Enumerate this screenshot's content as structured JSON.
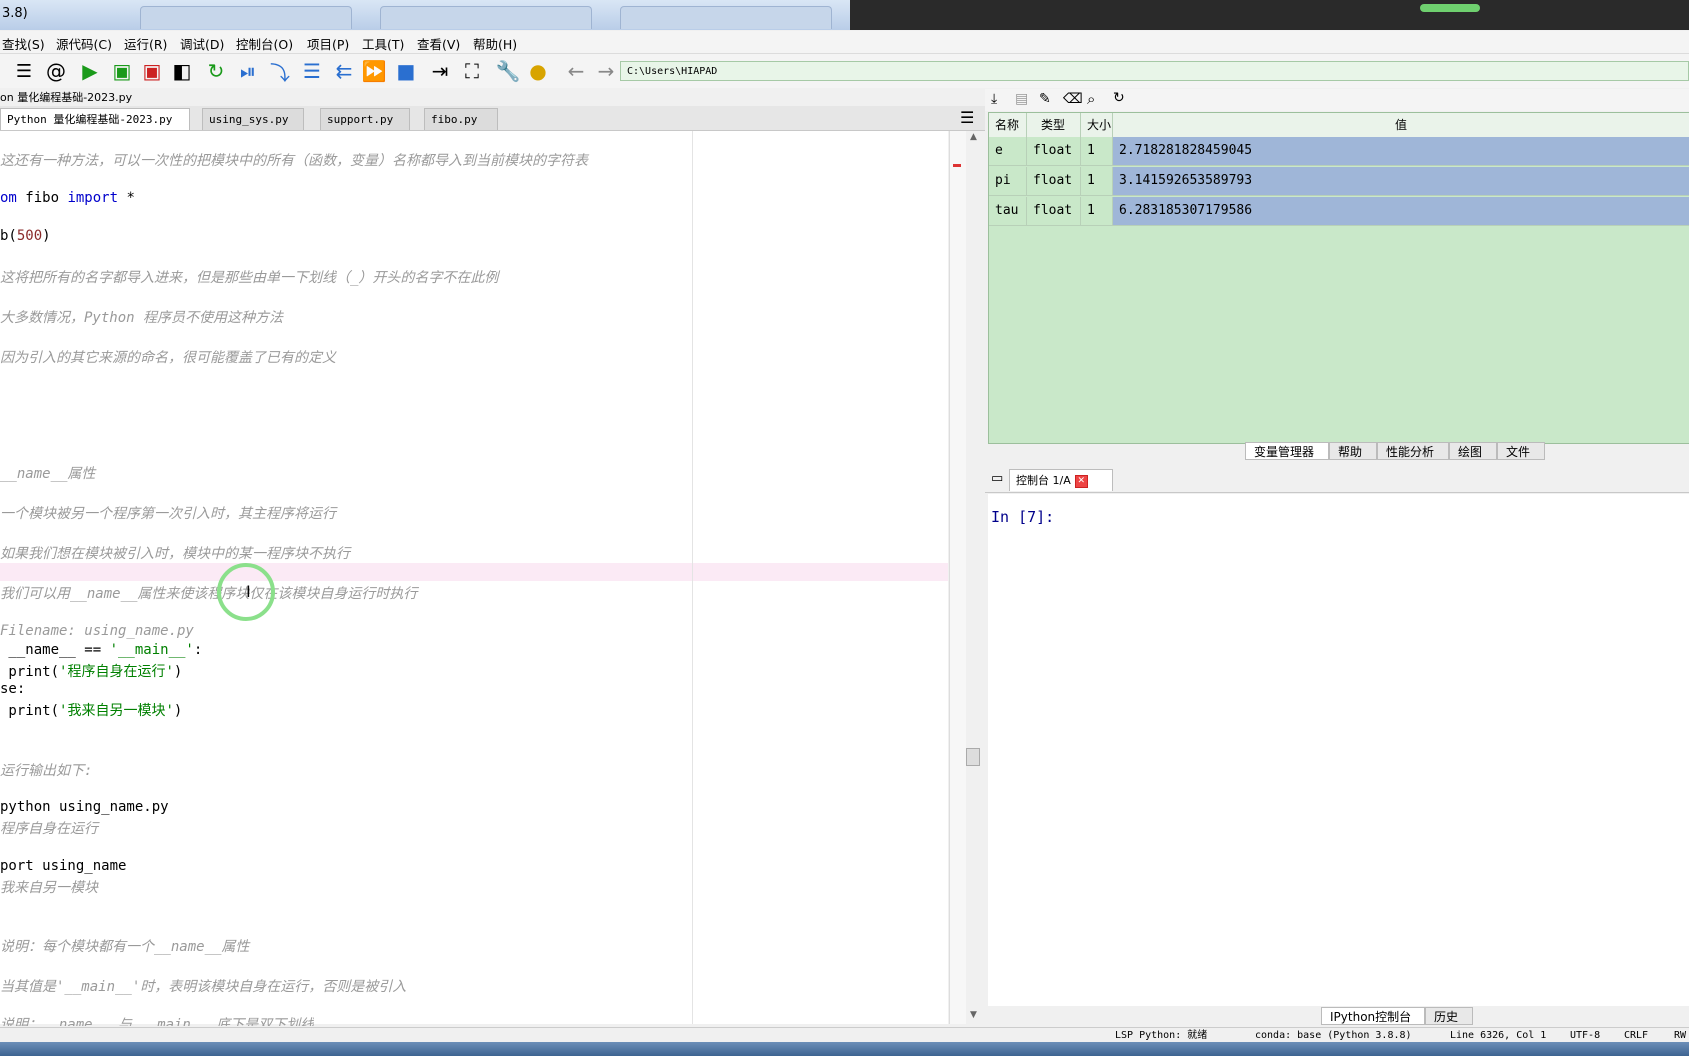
{
  "window": {
    "title": "3.8)"
  },
  "menu": [
    "查找(S)",
    "源代码(C)",
    "运行(R)",
    "调试(D)",
    "控制台(O)",
    "项目(P)",
    "工具(T)",
    "查看(V)",
    "帮助(H)"
  ],
  "toolbar": {
    "icons": [
      "list-icon",
      "at-icon",
      "run-icon",
      "run-cell-icon",
      "run-cell-advance-icon",
      "run-selection-icon",
      "rerun-icon",
      "debug-icon",
      "step-icon",
      "step-into-icon",
      "step-return-icon",
      "continue-icon",
      "stop-icon",
      "maximize-pane-icon",
      "fullscreen-icon",
      "wrench-icon",
      "python-path-icon",
      "back-arrow-icon",
      "forward-arrow-icon"
    ],
    "path": "C:\\Users\\HIAPAD"
  },
  "editor": {
    "filepath": "on 量化编程基础-2023.py",
    "tabs": [
      {
        "label": "Python 量化编程基础-2023.py",
        "active": true
      },
      {
        "label": "using_sys.py",
        "active": false
      },
      {
        "label": "support.py",
        "active": false
      },
      {
        "label": "fibo.py",
        "active": false
      }
    ],
    "lines": {
      "l1": "这还有一种方法，可以一次性的把模块中的所有（函数，变量）名称都导入到当前模块的字符表",
      "l2_kw1": "om ",
      "l2_id": "fibo ",
      "l2_kw2": "import",
      "l2_rest": " *",
      "l3_a": "b(",
      "l3_num": "500",
      "l3_b": ")",
      "l4": "这将把所有的名字都导入进来，但是那些由单一下划线（_）开头的名字不在此例",
      "l5": "大多数情况，Python 程序员不使用这种方法",
      "l6": "因为引入的其它来源的命名，很可能覆盖了已有的定义",
      "l7": "__name__属性",
      "l8": "一个模块被另一个程序第一次引入时，其主程序将运行",
      "l9": "如果我们想在模块被引入时，模块中的某一程序块不执行",
      "l10": "我们可以用__name__属性来使该程序块仅在该模块自身运行时执行",
      "l11": "Filename: using_name.py",
      "l12_a": " __name__ == ",
      "l12_str": "'__main__'",
      "l12_b": ":",
      "l13_a": " print(",
      "l13_str": "'程序自身在运行'",
      "l13_b": ")",
      "l14": "se:",
      "l15_a": " print(",
      "l15_str": "'我来自另一模块'",
      "l15_b": ")",
      "l16": "运行输出如下:",
      "l17": "python using_name.py",
      "l18": "程序自身在运行",
      "l19": "port using_name",
      "l20": "我来自另一模块",
      "l21": "说明：每个模块都有一个__name__属性",
      "l22": "当其值是'__main__'时，表明该模块自身在运行，否则是被引入",
      "l23": "说明：__name__ 与 __main__ 底下是双下划线"
    }
  },
  "variable_explorer": {
    "toolbar_icons": [
      "import-data-icon",
      "save-data-icon",
      "save-as-icon",
      "erase-icon",
      "search-icon",
      "refresh-icon"
    ],
    "headers": [
      "名称",
      "类型",
      "大小",
      "值"
    ],
    "rows": [
      {
        "name": "e",
        "type": "float",
        "size": "1",
        "value": "2.718281828459045"
      },
      {
        "name": "pi",
        "type": "float",
        "size": "1",
        "value": "3.141592653589793"
      },
      {
        "name": "tau",
        "type": "float",
        "size": "1",
        "value": "6.283185307179586"
      }
    ],
    "colors": {
      "row_bg": "#c9e8c9",
      "value_bg": "#9fb6d8"
    }
  },
  "pane_tabs": [
    "变量管理器",
    "帮助",
    "性能分析",
    "绘图",
    "文件"
  ],
  "console": {
    "tab_label": "控制台 1/A",
    "prompt": "In [7]:",
    "bottom_tabs": [
      "IPython控制台",
      "历史"
    ]
  },
  "statusbar": {
    "lsp": "LSP Python: 就绪",
    "conda": "conda: base (Python 3.8.8)",
    "position": "Line 6326, Col 1",
    "encoding": "UTF-8",
    "eol": "CRLF",
    "rw": "RW"
  }
}
